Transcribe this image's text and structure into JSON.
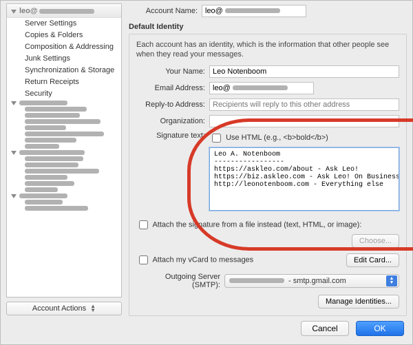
{
  "sidebar": {
    "account_label": "leo@",
    "items": [
      {
        "label": "Server Settings"
      },
      {
        "label": "Copies & Folders"
      },
      {
        "label": "Composition & Addressing"
      },
      {
        "label": "Junk Settings"
      },
      {
        "label": "Synchronization & Storage"
      },
      {
        "label": "Return Receipts"
      },
      {
        "label": "Security"
      }
    ],
    "account_actions_label": "Account Actions"
  },
  "main": {
    "account_name_label": "Account Name:",
    "account_name_value": "leo@",
    "section_title": "Default Identity",
    "section_desc": "Each account has an identity, which is the information that other people see when they read your messages.",
    "your_name_label": "Your Name:",
    "your_name_value": "Leo Notenboom",
    "email_label": "Email Address:",
    "email_value": "leo@",
    "reply_to_label": "Reply-to Address:",
    "reply_to_placeholder": "Recipients will reply to this other address",
    "org_label": "Organization:",
    "sig_label": "Signature text:",
    "use_html_label": "Use HTML (e.g., <b>bold</b>)",
    "signature_text": "Leo A. Notenboom\n-----------------\nhttps://askleo.com/about - Ask Leo!\nhttps://biz.askleo.com - Ask Leo! On Business\nhttp://leonotenboom.com - Everything else",
    "attach_file_label": "Attach the signature from a file instead (text, HTML, or image):",
    "choose_label": "Choose...",
    "attach_vcard_label": "Attach my vCard to messages",
    "edit_card_label": "Edit Card...",
    "smtp_label": "Outgoing Server (SMTP):",
    "smtp_value": "- smtp.gmail.com",
    "manage_identities_label": "Manage Identities..."
  },
  "footer": {
    "cancel": "Cancel",
    "ok": "OK"
  }
}
